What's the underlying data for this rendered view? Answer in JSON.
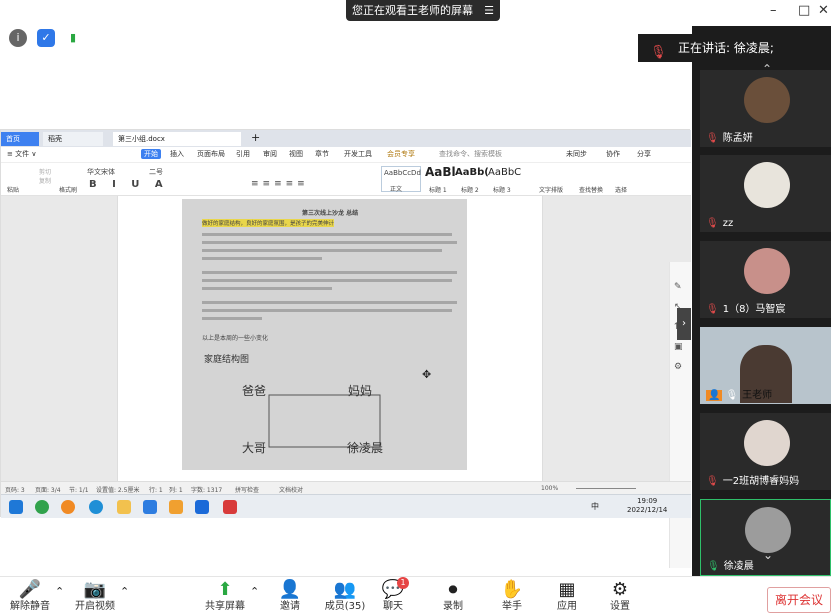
{
  "banner": {
    "text": "您正在观看王老师的屏幕",
    "menu_glyph": "☰"
  },
  "window_controls": {
    "minimize": "–",
    "maximize": "□",
    "close": "✕"
  },
  "speaking": {
    "label": "正在讲话: 徐凌晨;"
  },
  "participants": [
    {
      "name": "陈孟妍",
      "color": "#6a4f3a"
    },
    {
      "name": "zz",
      "color": "#e8e4dc"
    },
    {
      "name": "1（8）马智宸",
      "color": "#c8908a"
    },
    {
      "name": "王老师",
      "color": "#b8c4cc"
    },
    {
      "name": "一2班胡博睿妈妈",
      "color": "#e0d6cf"
    },
    {
      "name": "徐凌晨",
      "color": "#9c9c9c"
    }
  ],
  "wps": {
    "tabs": {
      "home": "首页",
      "shell": "稻壳",
      "doc": "第三小组.docx"
    },
    "ribbon_tabs": [
      "≡ 文件 ∨",
      "开始",
      "插入",
      "页面布局",
      "引用",
      "审阅",
      "视图",
      "章节",
      "开发工具",
      "会员专享"
    ],
    "search": "查找命令、搜索模板",
    "ribbon_right": [
      "未同步",
      "协作",
      "分享"
    ],
    "clipboard": [
      "粘贴",
      "剪切",
      "复制",
      "格式刷"
    ],
    "font": "华文宋体",
    "size": "二号",
    "styles": [
      {
        "sample": "AaBbCcDd",
        "label": "正文"
      },
      {
        "sample": "AaBl",
        "label": "标题 1"
      },
      {
        "sample": "AaBb(",
        "label": "标题 2"
      },
      {
        "sample": "AaBbC",
        "label": "标题 3"
      }
    ],
    "tools": [
      "文字排版",
      "查找替换",
      "选择"
    ],
    "status": [
      "页码: 3",
      "页面: 3/4",
      "节: 1/1",
      "设置值: 2.5厘米",
      "行: 1",
      "列: 1",
      "字数: 1317",
      "拼写检查",
      "文档校对"
    ],
    "zoom": "100%"
  },
  "document": {
    "heading": "第三次线上沙龙 总结",
    "highlight_line": "做好的家庭结构，良好的家庭氛围，是孩子的完美伸计",
    "caption": "以上是本周的一些小变化",
    "diagram_title": "家庭结构图",
    "nodes": {
      "tl": "爸爸",
      "tr": "妈妈",
      "bl": "大哥",
      "br": "徐凌晨"
    }
  },
  "taskbar": {
    "time": "19:09",
    "date": "2022/12/14",
    "ime": "中"
  },
  "toolbar": [
    {
      "label": "解除静音",
      "glyph": "🎤"
    },
    {
      "label": "开启视频",
      "glyph": "📷"
    },
    {
      "label": "共享屏幕",
      "glyph": "⬆"
    },
    {
      "label": "邀请",
      "glyph": "👤"
    },
    {
      "label": "成员(35)",
      "glyph": "👥"
    },
    {
      "label": "聊天",
      "glyph": "💬",
      "badge": "1"
    },
    {
      "label": "录制",
      "glyph": "⏺"
    },
    {
      "label": "举手",
      "glyph": "✋"
    },
    {
      "label": "应用",
      "glyph": "▦"
    },
    {
      "label": "设置",
      "glyph": "⚙"
    }
  ],
  "leave": "离开会议"
}
